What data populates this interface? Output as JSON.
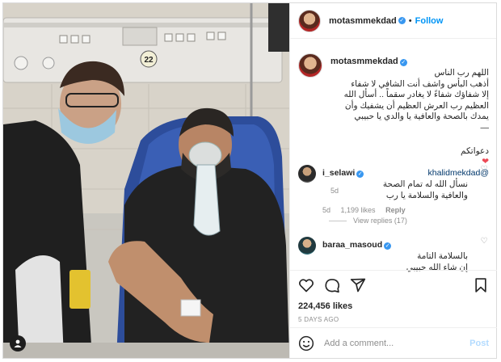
{
  "post": {
    "username": "motasmmekdad",
    "follow_label": "Follow",
    "dot": "•",
    "caption_text": "اللهم رب الناس\nأذهب البأس واشف أنت الشافي لا شفاء\nإلا شفاؤك شفاءً لا يغادر سقماً .. أسأل الله\nالعظيم رب العرش العظيم أن يشفيك وأن\nيمدك بالصحة والعافية يا والدي يا حبيبي\n—",
    "caption_footer": "دعواتكم",
    "caption_mention": "@khalidmekdad",
    "caption_time": "5d",
    "photo_number": "22"
  },
  "comments": [
    {
      "username": "i_selawi",
      "text": "نسأل الله له تمام الصحة\nوالعافية والسلامة يا رب",
      "time": "5d",
      "likes": "1,199 likes",
      "reply_label": "Reply"
    },
    {
      "username": "baraa_masoud",
      "text": "بالسلامة التامة\nإن شاء الله حبيبي",
      "time": "",
      "likes": "",
      "reply_label": ""
    }
  ],
  "view_replies": "View replies (17)",
  "stats": {
    "likes": "224,456 likes",
    "ago": "5 DAYS AGO"
  },
  "add_comment": {
    "placeholder": "Add a comment...",
    "post_label": "Post"
  },
  "icons": [
    "heart-icon",
    "comment-icon",
    "share-icon",
    "save-icon",
    "emoji-icon",
    "tag-user-icon"
  ],
  "colors": {
    "accent": "#0095f6",
    "verified": "#3897f0",
    "heart": "#ed4956",
    "muted": "#8e8e8e"
  }
}
